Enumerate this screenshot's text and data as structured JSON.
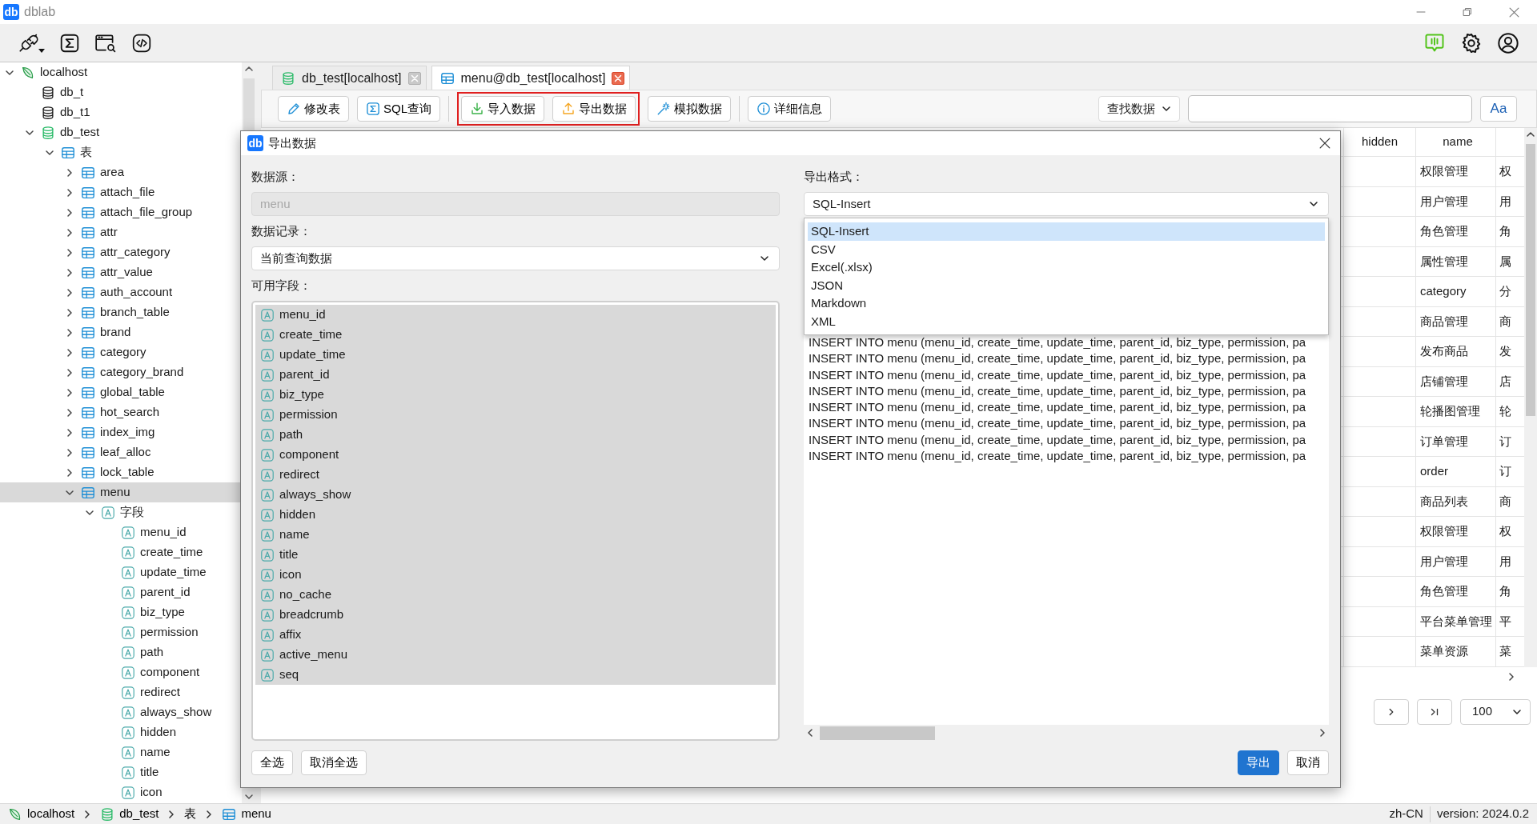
{
  "window": {
    "logo": "db",
    "title": "dblab"
  },
  "sidebar": {
    "tree": [
      {
        "label": "localhost",
        "kind": "server",
        "expanded": true,
        "selected": false,
        "children": [
          {
            "label": "db_t",
            "kind": "database",
            "selected": false
          },
          {
            "label": "db_t1",
            "kind": "database",
            "selected": false
          },
          {
            "label": "db_test",
            "kind": "database_active",
            "expanded": true,
            "selected": false,
            "children": [
              {
                "label": "表",
                "kind": "table",
                "expanded": true,
                "selected": false,
                "children": [
                  {
                    "label": "area",
                    "kind": "table",
                    "expanded": false,
                    "selected": false
                  },
                  {
                    "label": "attach_file",
                    "kind": "table",
                    "expanded": false,
                    "selected": false
                  },
                  {
                    "label": "attach_file_group",
                    "kind": "table",
                    "expanded": false,
                    "selected": false
                  },
                  {
                    "label": "attr",
                    "kind": "table",
                    "expanded": false,
                    "selected": false
                  },
                  {
                    "label": "attr_category",
                    "kind": "table",
                    "expanded": false,
                    "selected": false
                  },
                  {
                    "label": "attr_value",
                    "kind": "table",
                    "expanded": false,
                    "selected": false
                  },
                  {
                    "label": "auth_account",
                    "kind": "table",
                    "expanded": false,
                    "selected": false
                  },
                  {
                    "label": "branch_table",
                    "kind": "table",
                    "expanded": false,
                    "selected": false
                  },
                  {
                    "label": "brand",
                    "kind": "table",
                    "expanded": false,
                    "selected": false
                  },
                  {
                    "label": "category",
                    "kind": "table",
                    "expanded": false,
                    "selected": false
                  },
                  {
                    "label": "category_brand",
                    "kind": "table",
                    "expanded": false,
                    "selected": false
                  },
                  {
                    "label": "global_table",
                    "kind": "table",
                    "expanded": false,
                    "selected": false
                  },
                  {
                    "label": "hot_search",
                    "kind": "table",
                    "expanded": false,
                    "selected": false
                  },
                  {
                    "label": "index_img",
                    "kind": "table",
                    "expanded": false,
                    "selected": false
                  },
                  {
                    "label": "leaf_alloc",
                    "kind": "table",
                    "expanded": false,
                    "selected": false
                  },
                  {
                    "label": "lock_table",
                    "kind": "table",
                    "expanded": false,
                    "selected": false
                  },
                  {
                    "label": "menu",
                    "kind": "table",
                    "expanded": true,
                    "selected": true,
                    "children": [
                      {
                        "label": "字段",
                        "kind": "field",
                        "expanded": true,
                        "selected": false,
                        "children": [
                          {
                            "label": "menu_id",
                            "kind": "field",
                            "selected": false
                          },
                          {
                            "label": "create_time",
                            "kind": "field",
                            "selected": false
                          },
                          {
                            "label": "update_time",
                            "kind": "field",
                            "selected": false
                          },
                          {
                            "label": "parent_id",
                            "kind": "field",
                            "selected": false
                          },
                          {
                            "label": "biz_type",
                            "kind": "field",
                            "selected": false
                          },
                          {
                            "label": "permission",
                            "kind": "field",
                            "selected": false
                          },
                          {
                            "label": "path",
                            "kind": "field",
                            "selected": false
                          },
                          {
                            "label": "component",
                            "kind": "field",
                            "selected": false
                          },
                          {
                            "label": "redirect",
                            "kind": "field",
                            "selected": false
                          },
                          {
                            "label": "always_show",
                            "kind": "field",
                            "selected": false
                          },
                          {
                            "label": "hidden",
                            "kind": "field",
                            "selected": false
                          },
                          {
                            "label": "name",
                            "kind": "field",
                            "selected": false
                          },
                          {
                            "label": "title",
                            "kind": "field",
                            "selected": false
                          },
                          {
                            "label": "icon",
                            "kind": "field",
                            "selected": false
                          }
                        ]
                      }
                    ]
                  }
                ]
              }
            ]
          }
        ]
      }
    ]
  },
  "tabs": [
    {
      "label": "db_test[localhost]",
      "kind": "database_active",
      "selected": false
    },
    {
      "label": "menu@db_test[localhost]",
      "kind": "table",
      "selected": true
    }
  ],
  "actions": [
    {
      "label": "修改表",
      "kind": "edit",
      "highlighted": false
    },
    {
      "label": "SQL查询",
      "kind": "sql",
      "highlighted": false
    },
    {
      "label": "导入数据",
      "kind": "import",
      "highlighted": true
    },
    {
      "label": "导出数据",
      "kind": "export",
      "highlighted": true
    },
    {
      "label": "模拟数据",
      "kind": "mock",
      "highlighted": false
    },
    {
      "label": "详细信息",
      "kind": "info",
      "highlighted": false
    }
  ],
  "search": {
    "mode": "查找数据",
    "case_button": "Aa"
  },
  "table": {
    "columns": [
      "hidden",
      "name"
    ],
    "rows": [
      {
        "name": "权限管理",
        "column_3": "权"
      },
      {
        "name": "用户管理",
        "column_3": "用"
      },
      {
        "name": "角色管理",
        "column_3": "角"
      },
      {
        "name": "属性管理",
        "column_3": "属"
      },
      {
        "name": "category",
        "column_3": "分"
      },
      {
        "name": "商品管理",
        "column_3": "商"
      },
      {
        "name": "发布商品",
        "column_3": "发"
      },
      {
        "name": "店铺管理",
        "column_3": "店"
      },
      {
        "name": "轮播图管理",
        "column_3": "轮"
      },
      {
        "name": "订单管理",
        "column_3": "订"
      },
      {
        "name": "order",
        "column_3": "订"
      },
      {
        "name": "商品列表",
        "column_3": "商"
      },
      {
        "name": "权限管理",
        "column_3": "权"
      },
      {
        "name": "用户管理",
        "column_3": "用"
      },
      {
        "name": "角色管理",
        "column_3": "角"
      },
      {
        "name": "平台菜单管理",
        "column_3": "平"
      },
      {
        "name": "菜单资源",
        "column_3": "菜"
      }
    ]
  },
  "pagination": {
    "page_size": "100"
  },
  "dialog": {
    "logo": "db",
    "title": "导出数据",
    "source_label": "数据源：",
    "source": {
      "value": "menu",
      "disabled": true
    },
    "records_label": "数据记录：",
    "records": "当前查询数据",
    "fields_label": "可用字段：",
    "fields": [
      {
        "label": "menu_id",
        "selected": true
      },
      {
        "label": "create_time",
        "selected": true
      },
      {
        "label": "update_time",
        "selected": true
      },
      {
        "label": "parent_id",
        "selected": true
      },
      {
        "label": "biz_type",
        "selected": true
      },
      {
        "label": "permission",
        "selected": true
      },
      {
        "label": "path",
        "selected": true
      },
      {
        "label": "component",
        "selected": true
      },
      {
        "label": "redirect",
        "selected": true
      },
      {
        "label": "always_show",
        "selected": true
      },
      {
        "label": "hidden",
        "selected": true
      },
      {
        "label": "name",
        "selected": true
      },
      {
        "label": "title",
        "selected": true
      },
      {
        "label": "icon",
        "selected": true
      },
      {
        "label": "no_cache",
        "selected": true
      },
      {
        "label": "breadcrumb",
        "selected": true
      },
      {
        "label": "affix",
        "selected": true
      },
      {
        "label": "active_menu",
        "selected": true
      },
      {
        "label": "seq",
        "selected": true
      }
    ],
    "select_all": "全选",
    "deselect_all": "取消全选",
    "format_label": "导出格式：",
    "format": "SQL-Insert",
    "format_options": [
      {
        "label": "SQL-Insert",
        "selected": true
      },
      {
        "label": "CSV",
        "selected": false
      },
      {
        "label": "Excel(.xlsx)",
        "selected": false
      },
      {
        "label": "JSON",
        "selected": false
      },
      {
        "label": "Markdown",
        "selected": false
      },
      {
        "label": "XML",
        "selected": false
      }
    ],
    "preview_lines": [
      "INSERT INTO menu (menu_id, create_time, update_time, parent_id, biz_type, permission, pa",
      "INSERT INTO menu (menu_id, create_time, update_time, parent_id, biz_type, permission, pa",
      "INSERT INTO menu (menu_id, create_time, update_time, parent_id, biz_type, permission, pa",
      "INSERT INTO menu (menu_id, create_time, update_time, parent_id, biz_type, permission, pa",
      "INSERT INTO menu (menu_id, create_time, update_time, parent_id, biz_type, permission, pa",
      "INSERT INTO menu (menu_id, create_time, update_time, parent_id, biz_type, permission, pa",
      "INSERT INTO menu (menu_id, create_time, update_time, parent_id, biz_type, permission, pa",
      "INSERT INTO menu (menu_id, create_time, update_time, parent_id, biz_type, permission, pa"
    ],
    "export": "导出",
    "cancel": "取消"
  },
  "status_bar": {
    "breadcrumbs": [
      {
        "label": "localhost",
        "kind": "server"
      },
      {
        "label": "db_test",
        "kind": "database_active"
      },
      {
        "label": "表",
        "kind": "none"
      },
      {
        "label": "menu",
        "kind": "table"
      }
    ],
    "locale": "zh-CN",
    "version": "version: 2024.0.2"
  }
}
